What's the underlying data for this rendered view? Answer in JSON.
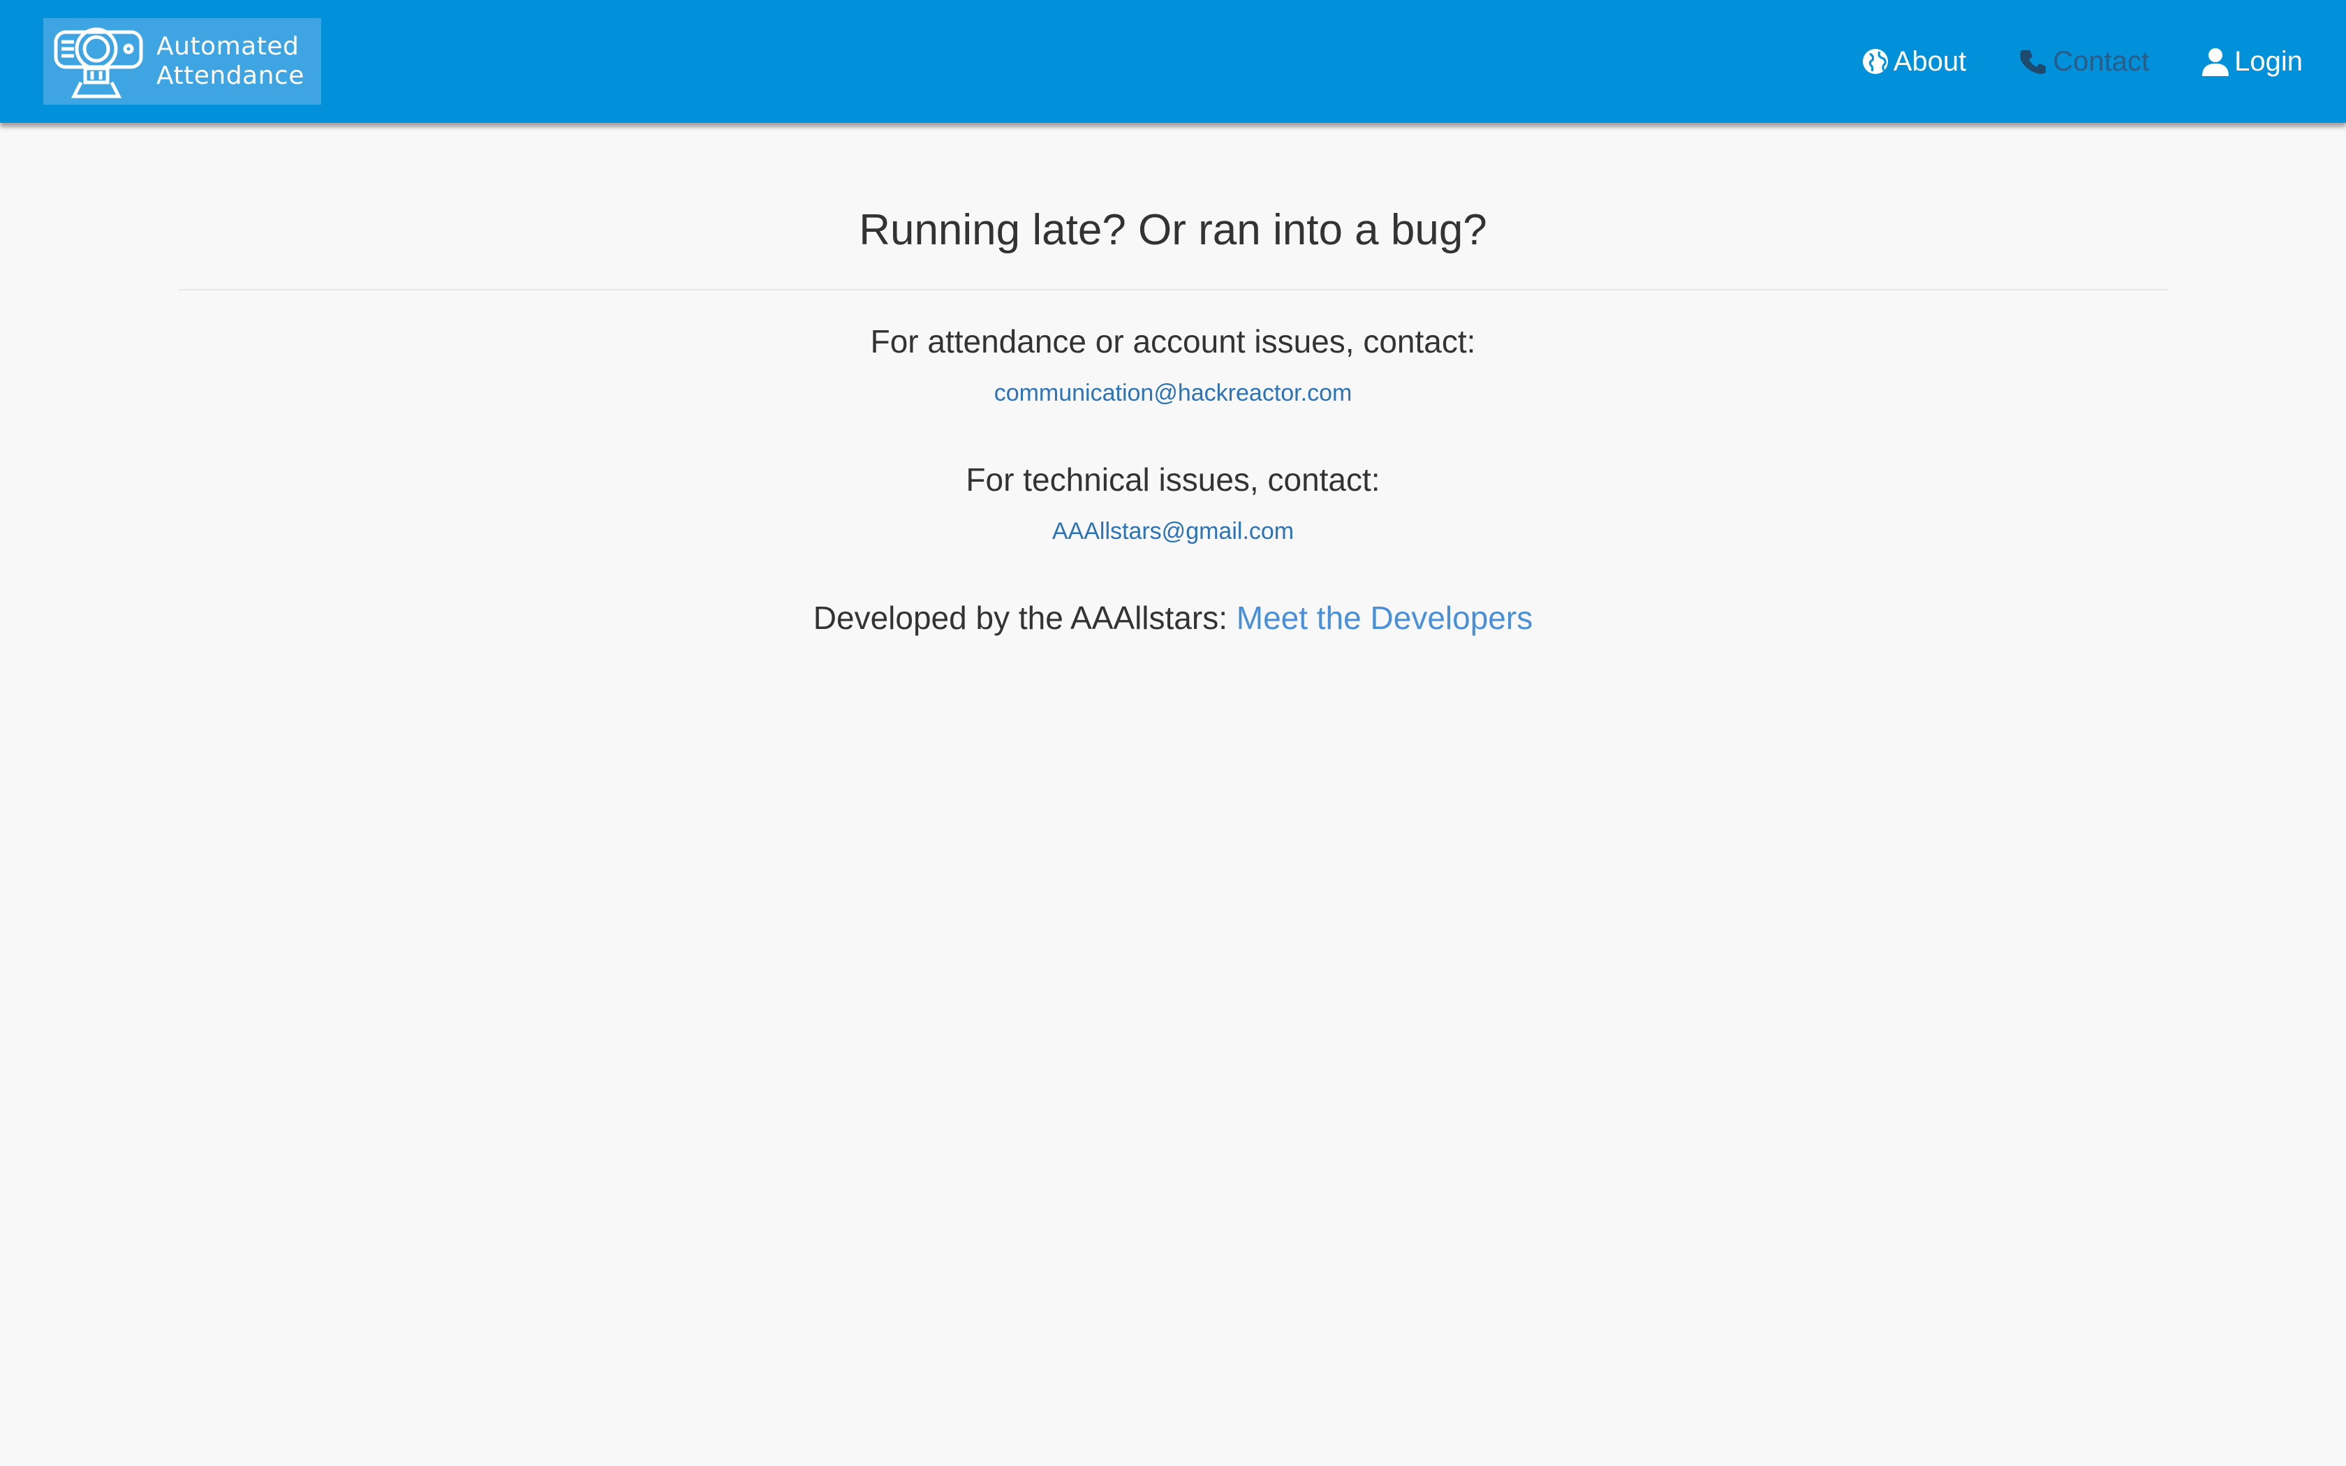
{
  "navbar": {
    "logo_line1": "Automated",
    "logo_line2": "Attendance",
    "logo_icon": "camera-icon",
    "items": [
      {
        "label": "About",
        "icon": "globe-icon"
      },
      {
        "label": "Contact",
        "icon": "phone-icon"
      },
      {
        "label": "Login",
        "icon": "user-icon"
      }
    ],
    "colors": {
      "bar": "#0191db",
      "logo_bg": "#3ea4e2"
    }
  },
  "main": {
    "title": "Running late? Or ran into a bug?",
    "attendance_heading": "For attendance or account issues, contact:",
    "attendance_email": "communication@hackreactor.com",
    "technical_heading": "For technical issues, contact:",
    "technical_email": "AAAllstars@gmail.com",
    "developed_by": "Developed by the AAAllstars: ",
    "meet_link": "Meet the Developers"
  }
}
